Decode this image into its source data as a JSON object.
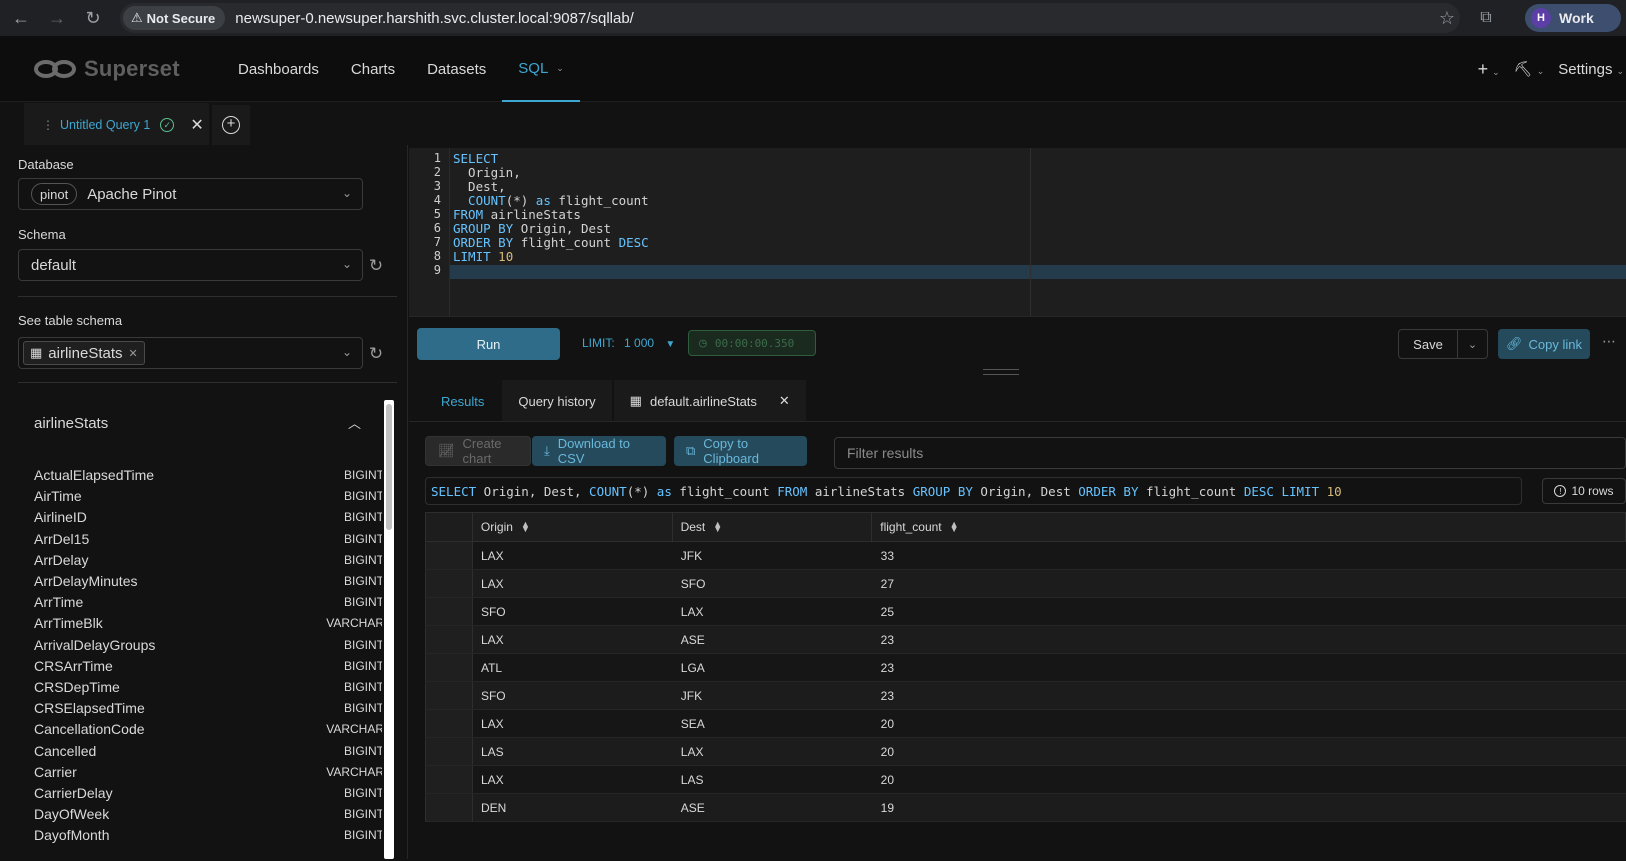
{
  "browser": {
    "security_label": "Not Secure",
    "url": "newsuper-0.newsuper.harshith.svc.cluster.local:9087/sqllab/",
    "profile_initial": "H",
    "profile_label": "Work"
  },
  "header": {
    "logo_text": "Superset",
    "nav": [
      {
        "label": "Dashboards"
      },
      {
        "label": "Charts"
      },
      {
        "label": "Datasets"
      },
      {
        "label": "SQL"
      }
    ],
    "settings_label": "Settings"
  },
  "query_tab": {
    "label": "Untitled Query 1"
  },
  "left": {
    "database_label": "Database",
    "database_tag": "pinot",
    "database_value": "Apache Pinot",
    "schema_label": "Schema",
    "schema_value": "default",
    "table_schema_label": "See table schema",
    "table_tag": "airlineStats",
    "table_title": "airlineStats",
    "columns": [
      {
        "name": "ActualElapsedTime",
        "type": "BIGINT"
      },
      {
        "name": "AirTime",
        "type": "BIGINT"
      },
      {
        "name": "AirlineID",
        "type": "BIGINT"
      },
      {
        "name": "ArrDel15",
        "type": "BIGINT"
      },
      {
        "name": "ArrDelay",
        "type": "BIGINT"
      },
      {
        "name": "ArrDelayMinutes",
        "type": "BIGINT"
      },
      {
        "name": "ArrTime",
        "type": "BIGINT"
      },
      {
        "name": "ArrTimeBlk",
        "type": "VARCHAR"
      },
      {
        "name": "ArrivalDelayGroups",
        "type": "BIGINT"
      },
      {
        "name": "CRSArrTime",
        "type": "BIGINT"
      },
      {
        "name": "CRSDepTime",
        "type": "BIGINT"
      },
      {
        "name": "CRSElapsedTime",
        "type": "BIGINT"
      },
      {
        "name": "CancellationCode",
        "type": "VARCHAR"
      },
      {
        "name": "Cancelled",
        "type": "BIGINT"
      },
      {
        "name": "Carrier",
        "type": "VARCHAR"
      },
      {
        "name": "CarrierDelay",
        "type": "BIGINT"
      },
      {
        "name": "DayOfWeek",
        "type": "BIGINT"
      },
      {
        "name": "DayofMonth",
        "type": "BIGINT"
      }
    ]
  },
  "editor": {
    "line_numbers": [
      "1",
      "2",
      "3",
      "4",
      "5",
      "6",
      "7",
      "8",
      "9"
    ],
    "lines": {
      "l1_kw": "SELECT",
      "l2": "  Origin,",
      "l3": "  Dest,",
      "l4_kw": "  COUNT",
      "l4_mid": "(*) ",
      "l4_kw2": "as",
      "l4_rest": " flight_count",
      "l5_kw": "FROM",
      "l5_rest": " airlineStats",
      "l6_kw": "GROUP BY",
      "l6_rest": " Origin, Dest",
      "l7_kw": "ORDER BY",
      "l7_rest": " flight_count ",
      "l7_kw2": "DESC",
      "l8_kw": "LIMIT",
      "l8_num": " 10"
    }
  },
  "toolbar": {
    "run_label": "Run",
    "limit_label": "LIMIT:",
    "limit_value": "1 000",
    "timer": "00:00:00.350",
    "save_label": "Save",
    "copy_link_label": "Copy link"
  },
  "results": {
    "tabs": [
      {
        "label": "Results"
      },
      {
        "label": "Query history"
      },
      {
        "label": "default.airlineStats"
      }
    ],
    "create_chart_label": "Create chart",
    "download_csv_label": "Download to CSV",
    "copy_clipboard_label": "Copy to Clipboard",
    "filter_placeholder": "Filter results",
    "sql": {
      "k1": "SELECT",
      "t1": " Origin, Dest, ",
      "k2": "COUNT",
      "t2": "(*) ",
      "k3": "as",
      "t3": " flight_count ",
      "k4": "FROM",
      "t4": " airlineStats ",
      "k5": "GROUP BY",
      "t5": " Origin, Dest ",
      "k6": "ORDER BY",
      "t6": " flight_count ",
      "k7": "DESC",
      "t7": " ",
      "k8": "LIMIT",
      "t8": " ",
      "n1": "10"
    },
    "row_count_label": "10 rows",
    "columns": [
      "Origin",
      "Dest",
      "flight_count"
    ],
    "rows": [
      [
        "LAX",
        "JFK",
        "33"
      ],
      [
        "LAX",
        "SFO",
        "27"
      ],
      [
        "SFO",
        "LAX",
        "25"
      ],
      [
        "LAX",
        "ASE",
        "23"
      ],
      [
        "ATL",
        "LGA",
        "23"
      ],
      [
        "SFO",
        "JFK",
        "23"
      ],
      [
        "LAX",
        "SEA",
        "20"
      ],
      [
        "LAS",
        "LAX",
        "20"
      ],
      [
        "LAX",
        "LAS",
        "20"
      ],
      [
        "DEN",
        "ASE",
        "19"
      ]
    ]
  }
}
